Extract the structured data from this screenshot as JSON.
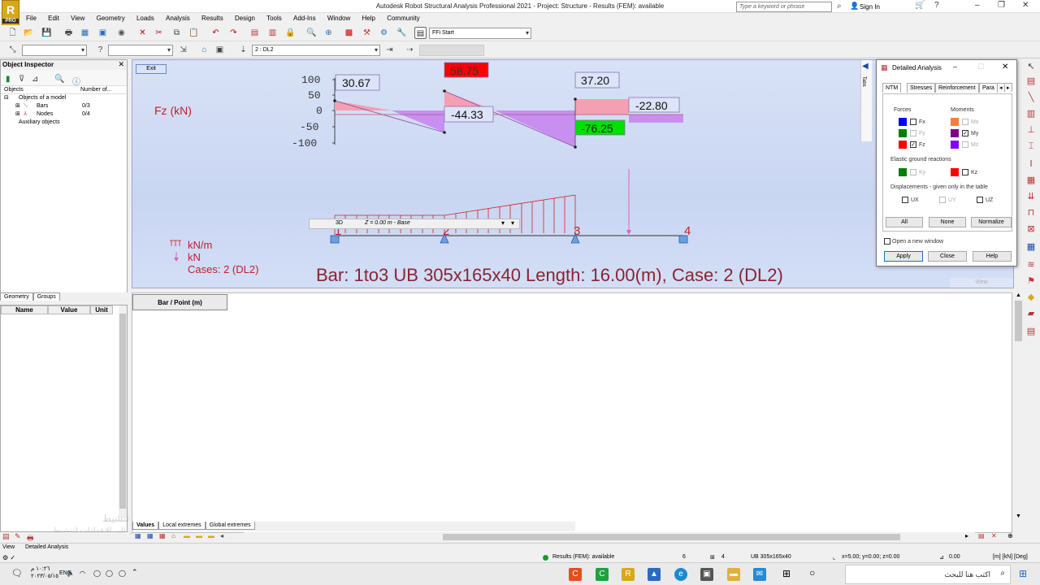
{
  "app": {
    "title": "Autodesk Robot Structural Analysis Professional 2021 - Project: Structure - Results (FEM): available",
    "logo_letter": "R",
    "logo_sub": "PRO",
    "search_placeholder": "Type a keyword or phrase",
    "sign_in": "Sign In"
  },
  "menu": [
    "File",
    "Edit",
    "View",
    "Geometry",
    "Loads",
    "Analysis",
    "Results",
    "Design",
    "Tools",
    "Add-Ins",
    "Window",
    "Help",
    "Community"
  ],
  "toolbar": {
    "frame_combo": "FFi Start",
    "case_combo": "2 : DL2"
  },
  "inspector": {
    "title": "Object Inspector",
    "col_objects": "Objects",
    "col_number": "Number of...",
    "tree": [
      {
        "label": "Objects of a model",
        "count": ""
      },
      {
        "label": "Bars",
        "count": "0/3"
      },
      {
        "label": "Nodes",
        "count": "0/4"
      },
      {
        "label": "Auxiliary objects",
        "count": ""
      }
    ],
    "tabs": [
      "Geometry",
      "Groups"
    ],
    "prop_cols": [
      "Name",
      "Value",
      "Unit"
    ]
  },
  "view": {
    "exit_label": "Exit",
    "diagram_label": "Fz  (kN)",
    "axis_ticks": [
      "100",
      "50",
      "0",
      "-50",
      "-100"
    ],
    "values": {
      "v1": "30.67",
      "v2": "58.75",
      "v3": "-44.33",
      "v4": "37.20",
      "v5": "-76.25",
      "v6": "-22.80"
    },
    "nodes": [
      "1",
      "2",
      "3",
      "4"
    ],
    "legend": {
      "load_unit": "kN/m",
      "force_unit": "kN",
      "cases": "Cases: 2 (DL2)"
    },
    "caption": "Bar: 1to3    UB 305x165x40  Length: 16.00(m), Case: 2 (DL2)",
    "view_tab": "3D",
    "view_plane": "Z = 0.00 m - Base",
    "view_button": "View",
    "tabs_label": "Tabs"
  },
  "lower": {
    "header": "Bar / Point (m)",
    "tabs": [
      "Values",
      "Local extremes",
      "Global extremes"
    ]
  },
  "status": {
    "left_tabs": [
      "View",
      "Detailed Analysis"
    ],
    "results": "Results (FEM): available",
    "count1": "6",
    "count2": "4",
    "section": "UB 305x165x40",
    "coords": "x=5.00; y=0.00; z=0.00",
    "angle": "0.00",
    "units": "[m] [kN] [Deg]"
  },
  "dialog": {
    "title": "Detailed Analysis",
    "tabs": [
      "NTM",
      "Stresses",
      "Reinforcement",
      "Para"
    ],
    "forces_label": "Forces",
    "moments_label": "Moments",
    "fx": "Fx",
    "fy": "Fy",
    "fz": "Fz",
    "mx": "Mx",
    "my": "My",
    "mz": "Mz",
    "elastic_label": "Elastic ground reactions",
    "ky": "Ky",
    "kz": "Kz",
    "disp_label": "Displacements - given only in the table",
    "ux": "UX",
    "uy": "UY",
    "uz": "UZ",
    "btn_all": "All",
    "btn_none": "None",
    "btn_normalize": "Normalize",
    "open_new": "Open a new window",
    "btn_apply": "Apply",
    "btn_close": "Close",
    "btn_help": "Help"
  },
  "taskbar": {
    "search": "اكتب هنا للبحث",
    "lang": "ENG",
    "time": "١٠:٢٦ م",
    "date": "٢٠٢٣/٠٥/١٥"
  },
  "watermark": {
    "line1": "تنشيط Windows",
    "line2": "انتقل إلى الإعدادات لتنشيط Windows"
  },
  "colors": {
    "positive_fill": "#f4a0b3",
    "negative_fill": "#c88ff0",
    "max_badge": "#ff0000",
    "min_badge": "#00e000",
    "load_red": "#d62020",
    "caption": "#8a2430"
  }
}
